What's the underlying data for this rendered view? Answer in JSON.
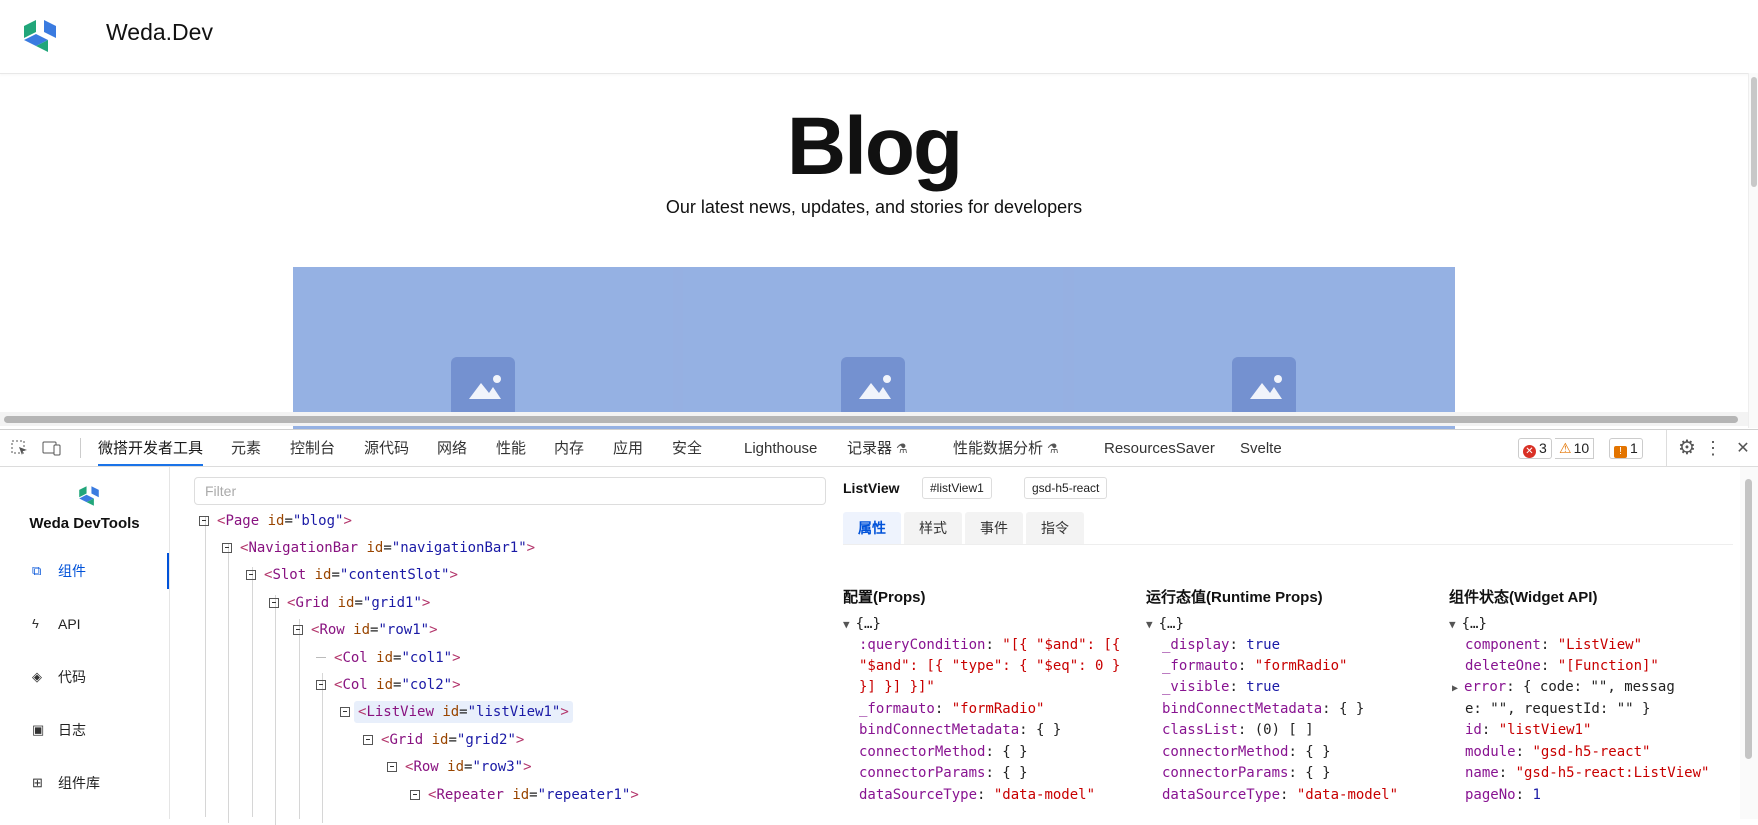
{
  "site": {
    "name": "Weda.Dev",
    "title": "Blog",
    "subtitle": "Our latest news, updates, and stories for developers",
    "highlight_color": "#789ada"
  },
  "devtools": {
    "tabs": [
      "微搭开发者工具",
      "元素",
      "控制台",
      "源代码",
      "网络",
      "性能",
      "内存",
      "应用",
      "安全",
      "Lighthouse",
      "记录器",
      "性能数据分析",
      "ResourcesSaver",
      "Svelte"
    ],
    "flask_icon": "⚗",
    "badges": {
      "errors": "3",
      "warnings": "10",
      "info": "1",
      "error_glyph": "✕",
      "warn_glyph": "⚠",
      "info_glyph": "!"
    },
    "menu_glyph": "⋮",
    "close_glyph": "✕",
    "settings_glyph": "⚙"
  },
  "weda": {
    "brand": "Weda DevTools",
    "nav": [
      {
        "label": "组件",
        "icon": "⧉",
        "icon_name": "component-tree-icon"
      },
      {
        "label": "API",
        "icon": "ϟ",
        "icon_name": "lightning-icon"
      },
      {
        "label": "代码",
        "icon": "◈",
        "icon_name": "code-layers-icon"
      },
      {
        "label": "日志",
        "icon": "▣",
        "icon_name": "terminal-icon"
      },
      {
        "label": "组件库",
        "icon": "⊞",
        "icon_name": "library-icon"
      }
    ],
    "filter_placeholder": "Filter",
    "tree": [
      {
        "tag": "Page",
        "attr": "id",
        "value": "blog"
      },
      {
        "tag": "NavigationBar",
        "attr": "id",
        "value": "navigationBar1"
      },
      {
        "tag": "Slot",
        "attr": "id",
        "value": "contentSlot"
      },
      {
        "tag": "Grid",
        "attr": "id",
        "value": "grid1"
      },
      {
        "tag": "Row",
        "attr": "id",
        "value": "row1"
      },
      {
        "tag": "Col",
        "attr": "id",
        "value": "col1"
      },
      {
        "tag": "Col",
        "attr": "id",
        "value": "col2"
      },
      {
        "tag": "ListView",
        "attr": "id",
        "value": "listView1"
      },
      {
        "tag": "Grid",
        "attr": "id",
        "value": "grid2"
      },
      {
        "tag": "Row",
        "attr": "id",
        "value": "row3"
      },
      {
        "tag": "Repeater",
        "attr": "id",
        "value": "repeater1"
      }
    ],
    "selected": {
      "name": "ListView",
      "id_tag": "#listView1",
      "module_tag": "gsd-h5-react",
      "tabs": [
        "属性",
        "样式",
        "事件",
        "指令"
      ]
    },
    "props": {
      "title": "配置(Props)",
      "summary": "{…}",
      "lines": [
        {
          "key": ":queryCondition",
          "value": "\"[{ \"$and\": [{"
        },
        {
          "key": "",
          "value": "\"$and\": [{ \"type\": { \"$eq\": 0 }"
        },
        {
          "key": "",
          "value": "}] }] }]\""
        },
        {
          "key": "_formauto",
          "value": "\"formRadio\""
        },
        {
          "key": "bindConnectMetadata",
          "value": "{ }"
        },
        {
          "key": "connectorMethod",
          "value": "{ }"
        },
        {
          "key": "connectorParams",
          "value": "{ }"
        },
        {
          "key": "dataSourceType",
          "value": "\"data-model\""
        }
      ]
    },
    "runtime": {
      "title": "运行态值(Runtime Props)",
      "summary": "{…}",
      "lines": [
        {
          "key": "_display",
          "value": "true"
        },
        {
          "key": "_formauto",
          "value": "\"formRadio\""
        },
        {
          "key": "_visible",
          "value": "true"
        },
        {
          "key": "bindConnectMetadata",
          "value": "{ }"
        },
        {
          "key": "classList",
          "value": "(0) [ ]"
        },
        {
          "key": "connectorMethod",
          "value": "{ }"
        },
        {
          "key": "connectorParams",
          "value": "{ }"
        },
        {
          "key": "dataSourceType",
          "value": "\"data-model\""
        }
      ]
    },
    "widget": {
      "title": "组件状态(Widget API)",
      "summary": "{…}",
      "lines": [
        {
          "key": "component",
          "value": "\"ListView\""
        },
        {
          "key": "deleteOne",
          "value": "\"[Function]\""
        },
        {
          "key": "error",
          "value": "{ code: \"\", messag"
        },
        {
          "key": "",
          "value": "e: \"\", requestId: \"\" }"
        },
        {
          "key": "id",
          "value": "\"listView1\""
        },
        {
          "key": "module",
          "value": "\"gsd-h5-react\""
        },
        {
          "key": "name",
          "value": "\"gsd-h5-react:ListView\""
        },
        {
          "key": "pageNo",
          "value": "1"
        }
      ]
    }
  }
}
